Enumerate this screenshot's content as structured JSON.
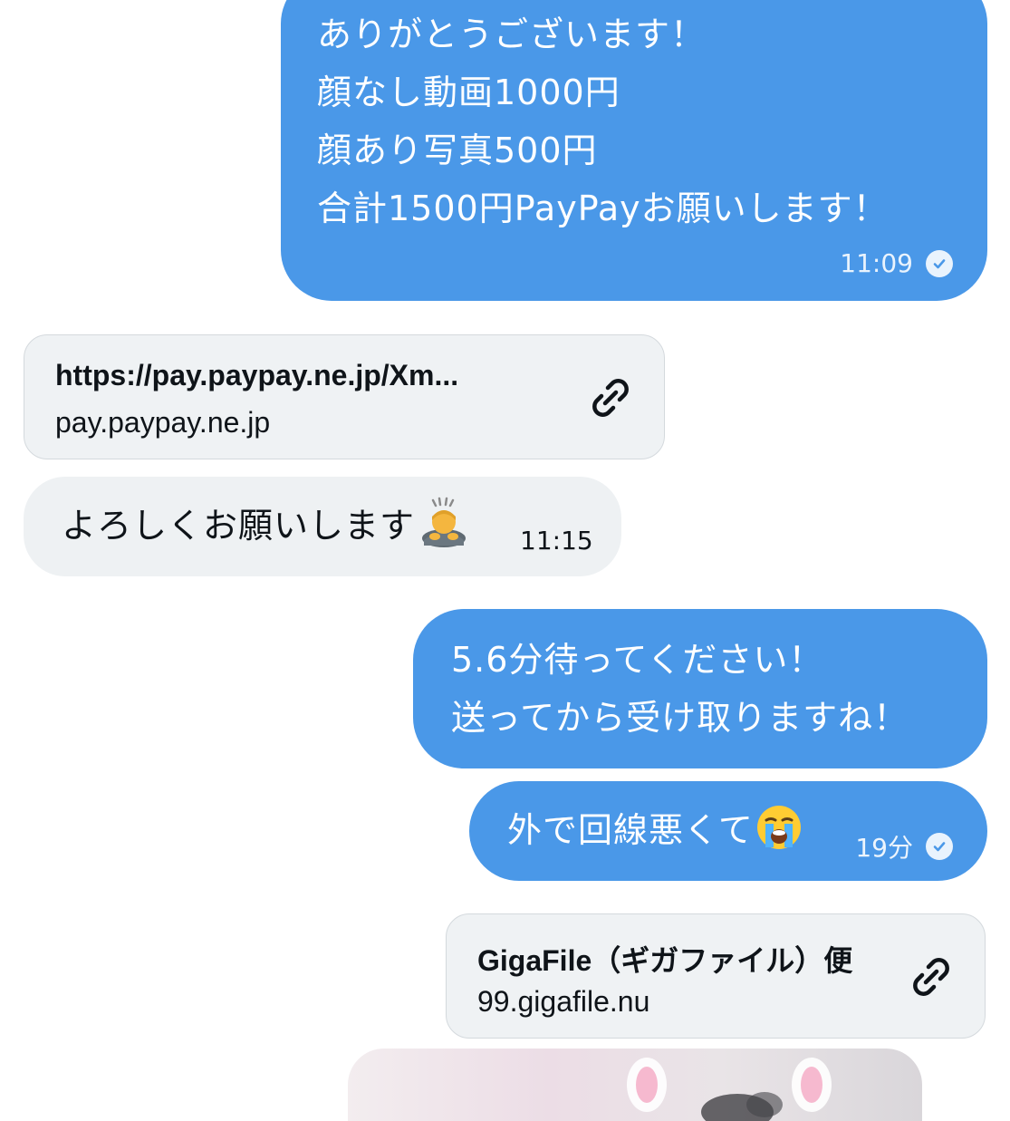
{
  "messages": {
    "m1": {
      "lines": [
        "ありがとうございます！",
        "顔なし動画1000円",
        "顔あり写真500円",
        "合計1500円PayPayお願いします！"
      ],
      "time": "11:09"
    },
    "link1": {
      "title": "https://pay.paypay.ne.jp/Xm...",
      "domain": "pay.paypay.ne.jp",
      "icon": "link-icon"
    },
    "m2": {
      "text": "よろしくお願いします",
      "emoji": "person-bowing-emoji",
      "time": "11:15"
    },
    "m3": {
      "lines": [
        "5.6分待ってください！",
        "送ってから受け取りますね！"
      ]
    },
    "m4": {
      "text": "外で回線悪くて",
      "emoji": "loudly-crying-face-emoji",
      "time": "19分"
    },
    "link2": {
      "title": "GigaFile（ギガファイル）便",
      "domain": "99.gigafile.nu",
      "icon": "link-icon"
    }
  },
  "colors": {
    "outgoing_bubble": "#4a98e8",
    "incoming_bubble": "#eef1f3",
    "link_card": "#eff2f4"
  }
}
